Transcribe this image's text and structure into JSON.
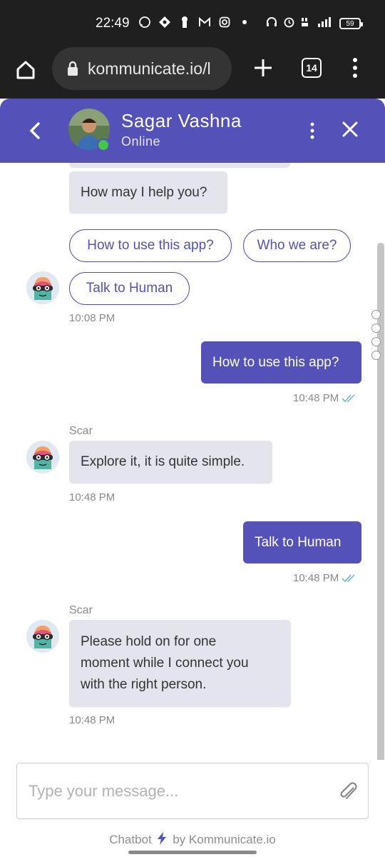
{
  "status_bar": {
    "time": "22:49",
    "battery": "59",
    "icons": [
      "whatsapp-icon",
      "location-icon",
      "keyhole-icon",
      "gmail-icon",
      "instagram-icon",
      "dot-icon",
      "headset-icon",
      "alarm-icon",
      "volte-icon",
      "signal-4g-icon"
    ]
  },
  "browser": {
    "url": "kommunicate.io/l",
    "tab_count": "14"
  },
  "header": {
    "name": "Sagar Vashna",
    "status": "Online"
  },
  "messages": {
    "greeting": "How may I help you?",
    "quick_replies": [
      "How to use this app?",
      "Who we are?",
      "Talk to Human"
    ],
    "time1": "10:08 PM",
    "out1": "How to use this app?",
    "time_out1": "10:48 PM",
    "sender1": "Scar",
    "in1": "Explore it, it is quite simple.",
    "time_in1": "10:48 PM",
    "out2": "Talk to Human",
    "time_out2": "10:48 PM",
    "sender2": "Scar",
    "in2_lines": [
      "Please hold on for one",
      "moment while I connect you",
      "with the right person."
    ],
    "time_in2": "10:48 PM"
  },
  "input": {
    "placeholder": "Type your message..."
  },
  "footer": {
    "prefix": "Chatbot",
    "suffix": "by Kommunicate.io"
  },
  "colors": {
    "brand": "#5451b9",
    "bubble_in": "#e4e4ec",
    "online": "#3fc84a",
    "tick": "#6aaee8"
  }
}
